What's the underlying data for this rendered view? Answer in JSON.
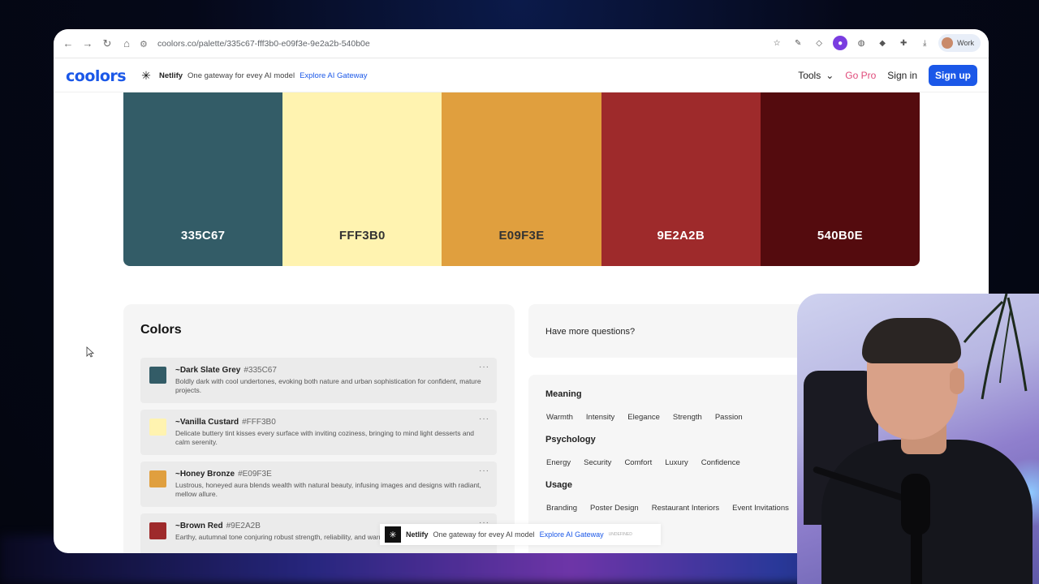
{
  "browser": {
    "url": "coolors.co/palette/335c67-fff3b0-e09f3e-9e2a2b-540b0e",
    "profile_label": "Work"
  },
  "header": {
    "logo": "coolors",
    "sponsor_brand": "Netlify",
    "sponsor_text": "One gateway for evey AI model",
    "sponsor_link": "Explore AI Gateway",
    "tools_label": "Tools",
    "gopro_label": "Go Pro",
    "signin_label": "Sign in",
    "signup_label": "Sign up"
  },
  "palette": {
    "swatches": [
      {
        "hex": "335C67",
        "color": "#335c67",
        "text_color": "#ffffff"
      },
      {
        "hex": "FFF3B0",
        "color": "#fff3b0",
        "text_color": "#333333"
      },
      {
        "hex": "E09F3E",
        "color": "#e09f3e",
        "text_color": "#333333"
      },
      {
        "hex": "9E2A2B",
        "color": "#9e2a2b",
        "text_color": "#ffffff"
      },
      {
        "hex": "540B0E",
        "color": "#540b0e",
        "text_color": "#ffffff"
      }
    ]
  },
  "colors_section": {
    "title": "Colors",
    "items": [
      {
        "name": "~Dark Slate Grey",
        "hex": "#335C67",
        "chip": "#335c67",
        "description": "Boldly dark with cool undertones, evoking both nature and urban sophistication for confident, mature projects."
      },
      {
        "name": "~Vanilla Custard",
        "hex": "#FFF3B0",
        "chip": "#fff3b0",
        "description": "Delicate buttery tint kisses every surface with inviting coziness, bringing to mind light desserts and calm serenity."
      },
      {
        "name": "~Honey Bronze",
        "hex": "#E09F3E",
        "chip": "#e09f3e",
        "description": "Lustrous, honeyed aura blends wealth with natural beauty, infusing images and designs with radiant, mellow allure."
      },
      {
        "name": "~Brown Red",
        "hex": "#9E2A2B",
        "chip": "#9e2a2b",
        "description": "Earthy, autumnal tone conjuring robust strength, reliability, and warmth, like rich soil and falling leaves."
      }
    ]
  },
  "questions": {
    "label": "Have more questions?"
  },
  "meaning": {
    "meaning_title": "Meaning",
    "meaning_tags": [
      "Warmth",
      "Intensity",
      "Elegance",
      "Strength",
      "Passion"
    ],
    "psychology_title": "Psychology",
    "psychology_tags": [
      "Energy",
      "Security",
      "Comfort",
      "Luxury",
      "Confidence"
    ],
    "usage_title": "Usage",
    "usage_tags": [
      "Branding",
      "Poster Design",
      "Restaurant Interiors",
      "Event Invitations"
    ]
  },
  "ad_bar": {
    "brand": "Netlify",
    "text": "One gateway for evey AI model",
    "link": "Explore AI Gateway",
    "small": "UNDEFINED"
  }
}
